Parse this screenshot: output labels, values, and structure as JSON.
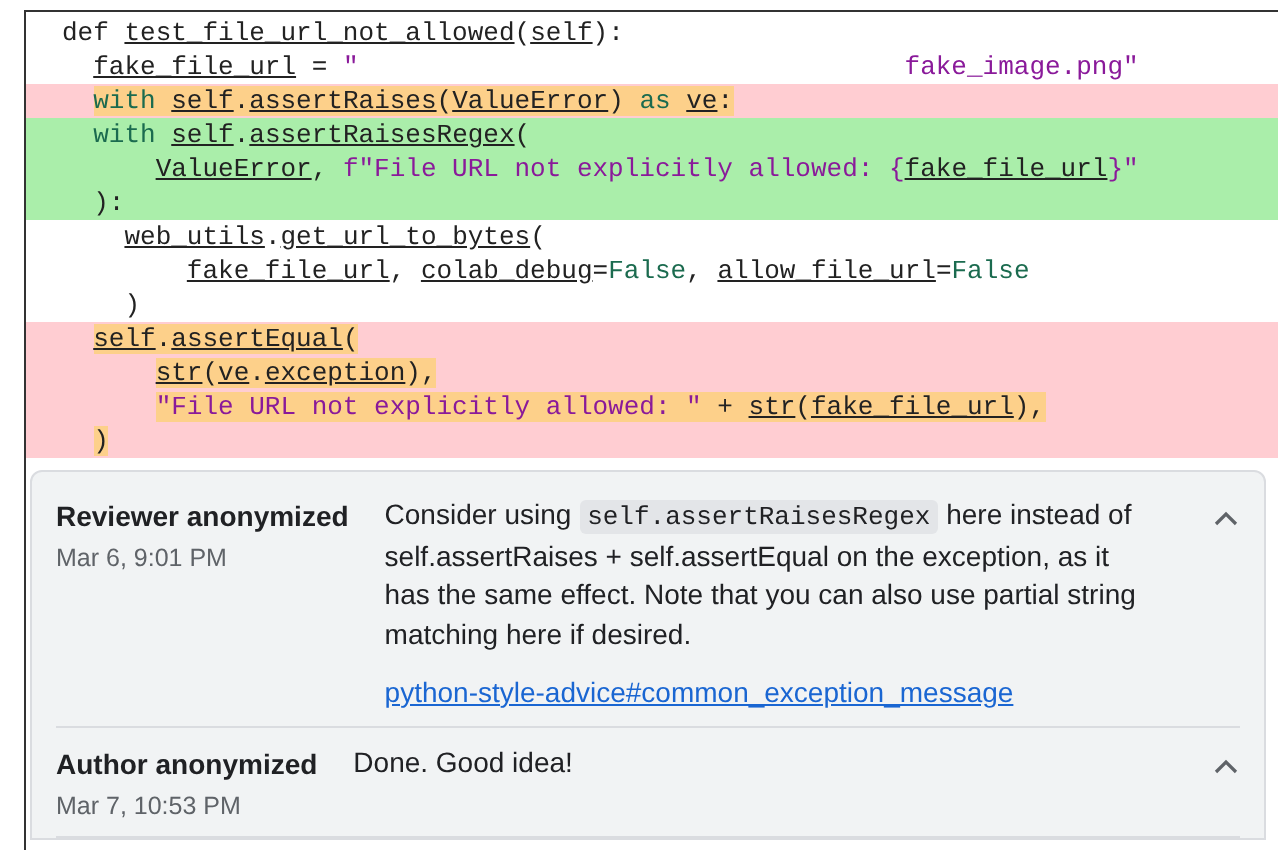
{
  "code_lines": [
    {
      "kind": "context",
      "highlighted": false,
      "tokens": [
        {
          "kind": "plain",
          "text": "def "
        },
        {
          "kind": "ref",
          "text": "test_file_url_not_allowed"
        },
        {
          "kind": "plain",
          "text": "("
        },
        {
          "kind": "ref",
          "text": "self"
        },
        {
          "kind": "plain",
          "text": "):"
        }
      ]
    },
    {
      "kind": "context",
      "highlighted": false,
      "tokens": [
        {
          "kind": "ref",
          "text": "  fake_file_url"
        },
        {
          "kind": "plain",
          "text": " = "
        },
        {
          "kind": "str",
          "text": "\"                                   fake_image.png\""
        }
      ]
    },
    {
      "kind": "removed",
      "highlighted": true,
      "tokens": [
        {
          "kind": "kw",
          "text": "  with "
        },
        {
          "kind": "ref",
          "text": "self"
        },
        {
          "kind": "plain",
          "text": "."
        },
        {
          "kind": "ref",
          "text": "assertRaises"
        },
        {
          "kind": "plain",
          "text": "("
        },
        {
          "kind": "ref",
          "text": "ValueError"
        },
        {
          "kind": "plain",
          "text": ") "
        },
        {
          "kind": "kw",
          "text": "as "
        },
        {
          "kind": "ref",
          "text": "ve"
        },
        {
          "kind": "plain",
          "text": ":"
        }
      ]
    },
    {
      "kind": "added",
      "highlighted": false,
      "tokens": [
        {
          "kind": "kw",
          "text": "  with "
        },
        {
          "kind": "ref",
          "text": "self"
        },
        {
          "kind": "plain",
          "text": "."
        },
        {
          "kind": "ref",
          "text": "assertRaisesRegex"
        },
        {
          "kind": "plain",
          "text": "("
        }
      ]
    },
    {
      "kind": "added",
      "highlighted": false,
      "tokens": [
        {
          "kind": "ref",
          "text": "      ValueError"
        },
        {
          "kind": "plain",
          "text": ", "
        },
        {
          "kind": "str",
          "text": "f\"File URL not explicitly allowed: {"
        },
        {
          "kind": "ref",
          "text": "fake_file_url"
        },
        {
          "kind": "str",
          "text": "}\""
        }
      ]
    },
    {
      "kind": "added",
      "highlighted": false,
      "tokens": [
        {
          "kind": "plain",
          "text": "  ):"
        }
      ]
    },
    {
      "kind": "context",
      "highlighted": false,
      "tokens": [
        {
          "kind": "ref",
          "text": "    web_utils"
        },
        {
          "kind": "plain",
          "text": "."
        },
        {
          "kind": "ref",
          "text": "get_url_to_bytes"
        },
        {
          "kind": "plain",
          "text": "("
        }
      ]
    },
    {
      "kind": "context",
      "highlighted": false,
      "tokens": [
        {
          "kind": "ref",
          "text": "        fake_file_url"
        },
        {
          "kind": "plain",
          "text": ", "
        },
        {
          "kind": "ref",
          "text": "colab_debug"
        },
        {
          "kind": "plain",
          "text": "="
        },
        {
          "kind": "kw",
          "text": "False"
        },
        {
          "kind": "plain",
          "text": ", "
        },
        {
          "kind": "ref",
          "text": "allow_file_url"
        },
        {
          "kind": "plain",
          "text": "="
        },
        {
          "kind": "kw",
          "text": "False"
        }
      ]
    },
    {
      "kind": "context",
      "highlighted": false,
      "tokens": [
        {
          "kind": "plain",
          "text": "    )"
        }
      ]
    },
    {
      "kind": "removed",
      "highlighted": true,
      "tokens": [
        {
          "kind": "ref",
          "text": "  self"
        },
        {
          "kind": "plain",
          "text": "."
        },
        {
          "kind": "ref",
          "text": "assertEqual"
        },
        {
          "kind": "plain",
          "text": "("
        }
      ]
    },
    {
      "kind": "removed",
      "highlighted": true,
      "tokens": [
        {
          "kind": "ref",
          "text": "      str"
        },
        {
          "kind": "plain",
          "text": "("
        },
        {
          "kind": "ref",
          "text": "ve"
        },
        {
          "kind": "plain",
          "text": "."
        },
        {
          "kind": "ref",
          "text": "exception"
        },
        {
          "kind": "plain",
          "text": "),"
        }
      ]
    },
    {
      "kind": "removed",
      "highlighted": true,
      "tokens": [
        {
          "kind": "str",
          "text": "      \"File URL not explicitly allowed: \""
        },
        {
          "kind": "plain",
          "text": " + "
        },
        {
          "kind": "ref",
          "text": "str"
        },
        {
          "kind": "plain",
          "text": "("
        },
        {
          "kind": "ref",
          "text": "fake_file_url"
        },
        {
          "kind": "plain",
          "text": "),"
        }
      ]
    },
    {
      "kind": "removed",
      "highlighted": true,
      "tokens": [
        {
          "kind": "plain",
          "text": "  )"
        }
      ]
    }
  ],
  "comments": [
    {
      "author": "Reviewer anonymized",
      "date": "Mar 6, 9:01 PM",
      "expanded": true,
      "body": [
        {
          "kind": "text",
          "text": "Consider using "
        },
        {
          "kind": "code",
          "text": "self.assertRaisesRegex"
        },
        {
          "kind": "text",
          "text": " here instead of self.assertRaises + self.assertEqual on the exception, as it has the same effect. Note that you can also use partial string matching here if desired."
        }
      ],
      "link": "python-style-advice#common_exception_message"
    },
    {
      "author": "Author anonymized",
      "date": "Mar 7, 10:53 PM",
      "expanded": true,
      "body": [
        {
          "kind": "text",
          "text": "Done. Good idea!"
        }
      ]
    }
  ]
}
